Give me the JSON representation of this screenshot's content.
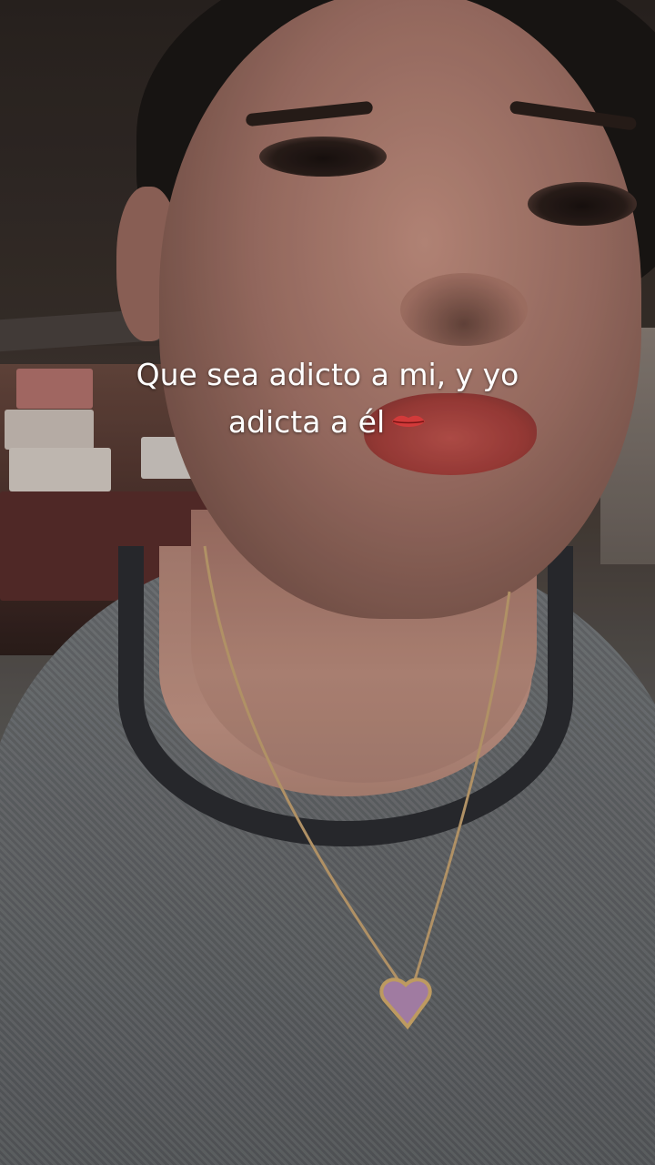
{
  "caption": {
    "line1": "Que sea adicto a mi, y yo",
    "line2": "adicta a él",
    "emoji": "lips-emoji"
  },
  "colors": {
    "caption_text": "#ffffff",
    "lips_emoji": "#d23a3a"
  }
}
